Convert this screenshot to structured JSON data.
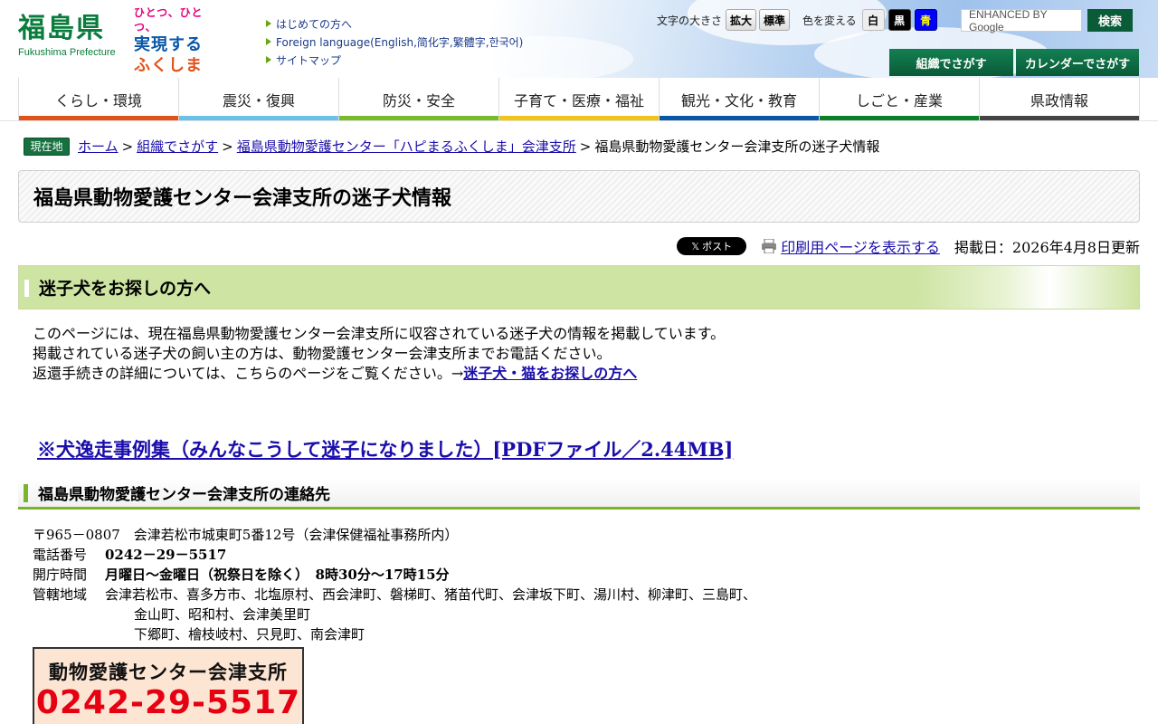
{
  "header": {
    "logo_title": "福島県",
    "logo_sub": "Fukushima Prefecture",
    "slogan_lines": [
      "ひとつ、ひとつ、",
      "実現する",
      "ふくしま"
    ],
    "links": [
      "はじめての方へ",
      "Foreign language(English,简化字,繁體字,한국어)",
      "サイトマップ"
    ],
    "font_size_label": "文字の大きさ",
    "font_size_buttons": [
      "拡大",
      "標準"
    ],
    "color_label": "色を変える",
    "color_buttons": [
      "白",
      "黒",
      "青"
    ],
    "search_placeholder": "ENHANCED BY Google",
    "search_button": "検索",
    "org_search": "組織でさがす",
    "calendar_search": "カレンダーでさがす"
  },
  "nav": [
    {
      "label": "くらし・環境",
      "color": "#e0521b"
    },
    {
      "label": "震災・復興",
      "color": "#6cc1e8"
    },
    {
      "label": "防災・安全",
      "color": "#7ab82c"
    },
    {
      "label": "子育て・医療・福祉",
      "color": "#f0c419"
    },
    {
      "label": "観光・文化・教育",
      "color": "#0a56a8"
    },
    {
      "label": "しごと・産業",
      "color": "#0d7f2a"
    },
    {
      "label": "県政情報",
      "color": "#444444"
    }
  ],
  "breadcrumb": {
    "badge": "現在地",
    "items": [
      "ホーム",
      "組織でさがす",
      "福島県動物愛護センター「ハピまるふくしま」会津支所"
    ],
    "current": "福島県動物愛護センター会津支所の迷子犬情報"
  },
  "page_title": "福島県動物愛護センター会津支所の迷子犬情報",
  "meta": {
    "x_post": "𝕏 ポスト",
    "print_link": "印刷用ページを表示する",
    "updated": "掲載日：2026年4月8日更新"
  },
  "section1": {
    "heading": "迷子犬をお探しの方へ",
    "line1": "このページには、現在福島県動物愛護センター会津支所に収容されている迷子犬の情報を掲載しています。",
    "line2": "掲載されている迷子犬の飼い主の方は、動物愛護センター会津支所までお電話ください。",
    "line3": "返還手続きの詳細については、こちらのページをご覧ください。→",
    "line3_link": "迷子犬・猫をお探しの方へ",
    "pdf_link": "※犬逸走事例集（みんなこうして迷子になりました）[PDFファイル／2.44MB]"
  },
  "contact": {
    "heading": "福島県動物愛護センター会津支所の連絡先",
    "address": "〒965－0807　会津若松市城東町5番12号（会津保健福祉事務所内）",
    "tel_label": "電話番号",
    "tel_value": "0242－29－5517",
    "hours_label": "開庁時間",
    "hours_value": "月曜日～金曜日（祝祭日を除く）　8時30分～17時15分",
    "area_label": "管轄地域",
    "area_line1": "会津若松市、喜多方市、北塩原村、西会津町、磐梯町、猪苗代町、会津坂下町、湯川村、柳津町、三島町、",
    "area_line2": "金山町、昭和村、会津美里町",
    "area_line3": "下郷町、檜枝岐村、只見町、南会津町"
  },
  "phone_banner": {
    "line1": "動物愛護センター会津支所",
    "line2": "0242-29-5517"
  }
}
